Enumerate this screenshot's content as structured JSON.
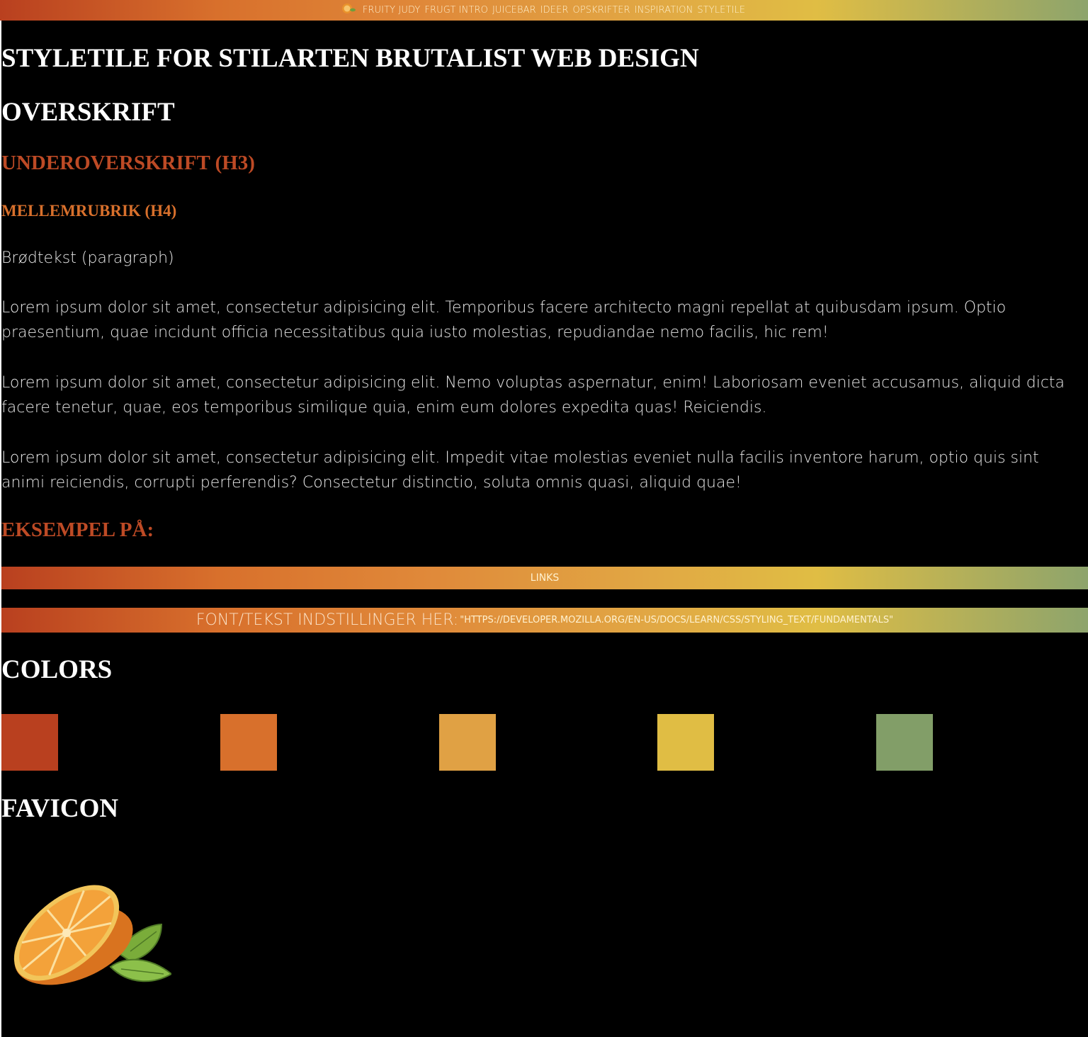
{
  "nav": {
    "logo_icon": "orange-fruit-icon",
    "items": [
      "FRUITY JUDY",
      "FRUGT INTRO",
      "JUICEBAR",
      "IDEER",
      "OPSKRIFTER",
      "INSPIRATION",
      "STYLETILE"
    ]
  },
  "headings": {
    "title": "STYLETILE FOR STILARTEN BRUTALIST WEB DESIGN",
    "h2": "OVERSKRIFT",
    "h3": "UNDEROVERSKRIFT (H3)",
    "h4": "MELLEMRUBRIK (H4)",
    "example": "EKSEMPEL PÅ:"
  },
  "body": {
    "label": "Brødtekst (paragraph)",
    "paragraphs": [
      "Lorem ipsum dolor sit amet, consectetur adipisicing elit. Temporibus facere architecto magni repellat at quibusdam ipsum. Optio praesentium, quae incidunt officia necessitatibus quia iusto molestias, repudiandae nemo facilis, hic rem!",
      "Lorem ipsum dolor sit amet, consectetur adipisicing elit. Nemo voluptas aspernatur, enim! Laboriosam eveniet accusamus, aliquid dicta facere tenetur, quae, eos temporibus similique quia, enim eum dolores expedita quas! Reiciendis.",
      "Lorem ipsum dolor sit amet, consectetur adipisicing elit. Impedit vitae molestias eveniet nulla facilis inventore harum, optio quis sint animi reiciendis, corrupti perferendis? Consectetur distinctio, soluta omnis quasi, aliquid quae!"
    ]
  },
  "links_bar": {
    "label": "LINKS"
  },
  "font_bar": {
    "label": "FONT/TEKST INDSTILLINGER HER:",
    "url": "\"HTTPS://DEVELOPER.MOZILLA.ORG/EN-US/DOCS/LEARN/CSS/STYLING_TEXT/FUNDAMENTALS\""
  },
  "colors": {
    "heading": "COLORS",
    "swatches": [
      "#b9401f",
      "#d8702c",
      "#e0a144",
      "#e0bd44",
      "#829e68"
    ]
  },
  "favicon": {
    "heading": "FAVICON",
    "image": "orange-half-with-leaves"
  }
}
